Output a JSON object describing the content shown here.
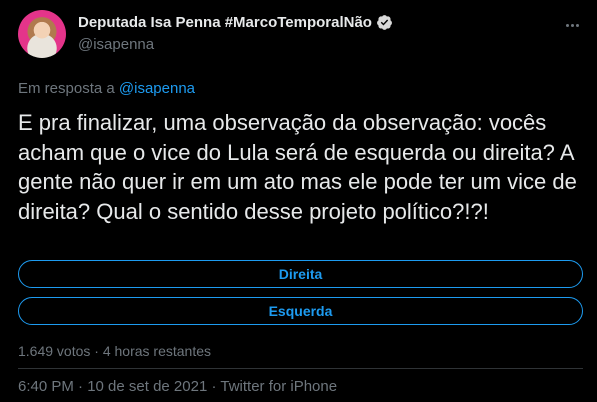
{
  "author": {
    "name": "Deputada Isa Penna #MarcoTemporalNão",
    "handle": "@isapenna",
    "verified": true
  },
  "reply": {
    "prefix": "Em resposta a",
    "mention": "@isapenna"
  },
  "tweet": {
    "text": "E pra finalizar, uma observação da observação: vocês acham que o vice do Lula será de esquerda ou direita? A gente não quer ir em um ato mas ele pode ter um vice de direita? Qual o sentido desse projeto político?!?!"
  },
  "poll": {
    "options": [
      "Direita",
      "Esquerda"
    ],
    "meta": "1.649 votos · 4 horas restantes"
  },
  "footer": {
    "timestamp": "6:40 PM · 10 de set de 2021 · Twitter for iPhone"
  },
  "colors": {
    "accent": "#1d9bf0",
    "background": "#000000",
    "muted": "#6e767d"
  }
}
